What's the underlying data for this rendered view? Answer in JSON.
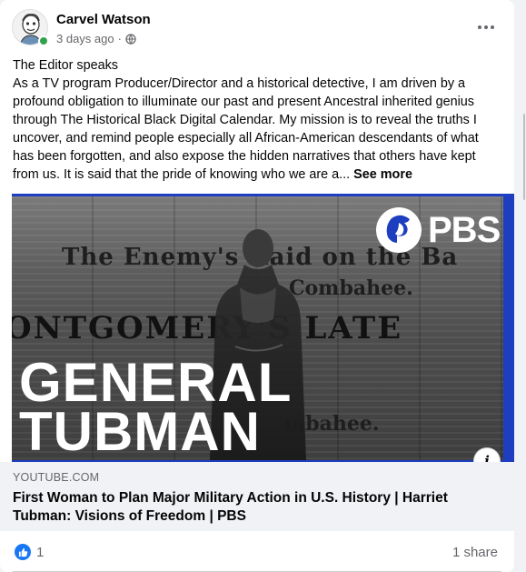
{
  "post": {
    "author": "Carvel Watson",
    "time": "3 days ago",
    "audience_icon": "globe-icon",
    "more_icon": "more-options-icon",
    "text_lines": [
      "The Editor speaks",
      "As a TV program Producer/Director and a historical detective, I am driven by a profound obligation to illuminate our past and present Ancestral inherited genius through The Historical Black Digital Calendar. My mission is to reveal the truths I uncover, and remind people especially all African-American descendants of what has been forgotten, and also expose the hidden narratives that others have kept from us. It is said that the pride of knowing who we are a..."
    ],
    "see_more": "See more"
  },
  "media": {
    "newspaper_headline_1": "The Enemy's Raid on the Ba",
    "newspaper_headline_2": "Combahee.",
    "newspaper_headline_3": "ONTGOMERY'S LATE",
    "newspaper_headline_4": "mbahee.",
    "logo_text": "PBS",
    "title_line_1": "GENERAL",
    "title_line_2": "TUBMAN",
    "info_icon": "info-icon"
  },
  "link": {
    "domain": "YOUTUBE.COM",
    "title": "First Woman to Plan Major Military Action in U.S. History | Harriet Tubman: Visions of Freedom | PBS"
  },
  "footer": {
    "reaction_icon": "like-icon",
    "like_count": "1",
    "share_count": "1 share"
  },
  "colors": {
    "accent": "#1877f2",
    "online": "#31a24c",
    "media_border": "#1d3fbf"
  }
}
